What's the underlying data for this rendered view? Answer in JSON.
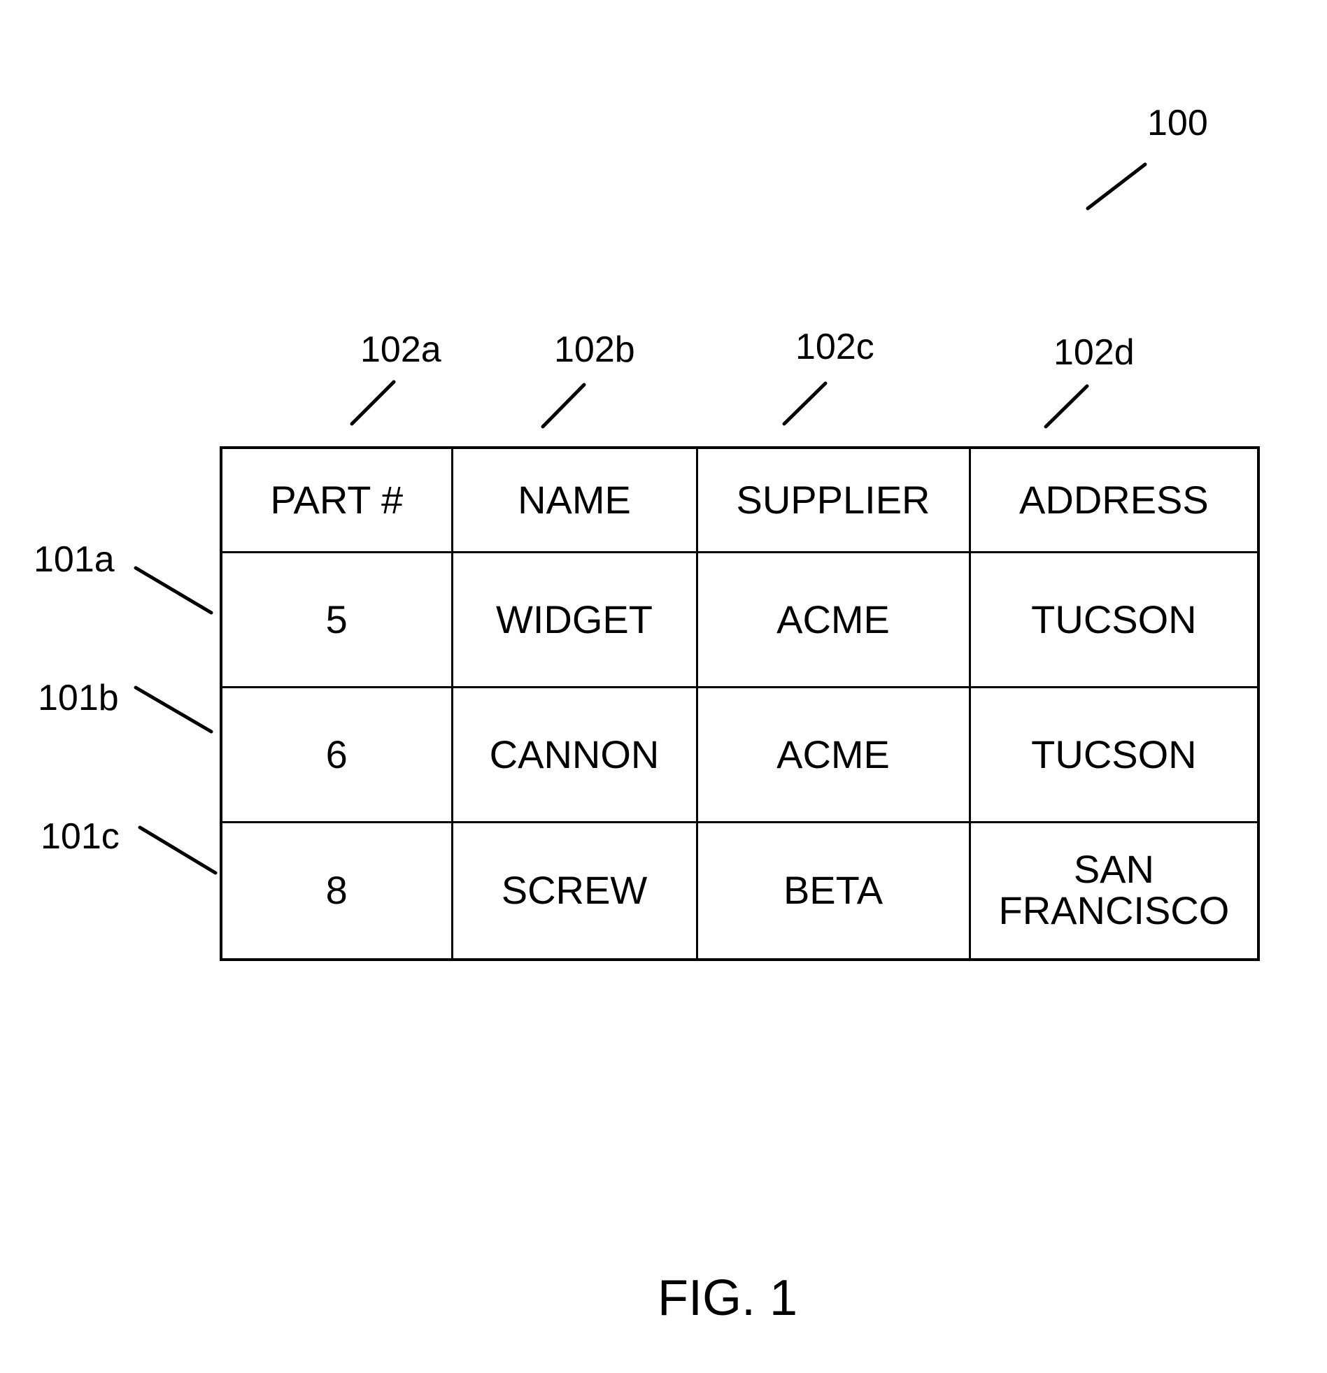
{
  "figure": {
    "caption": "FIG. 1",
    "reference": "100"
  },
  "column_refs": [
    "102a",
    "102b",
    "102c",
    "102d"
  ],
  "row_refs": [
    "101a",
    "101b",
    "101c"
  ],
  "table": {
    "headers": [
      "PART #",
      "NAME",
      "SUPPLIER",
      "ADDRESS"
    ],
    "rows": [
      [
        "5",
        "WIDGET",
        "ACME",
        "TUCSON"
      ],
      [
        "6",
        "CANNON",
        "ACME",
        "TUCSON"
      ],
      [
        "8",
        "SCREW",
        "BETA",
        "SAN FRANCISCO"
      ]
    ]
  }
}
